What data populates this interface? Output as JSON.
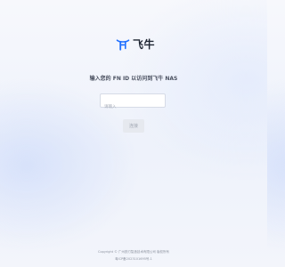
{
  "brand": {
    "name": "飞牛",
    "logo_icon": "fnos-bull-icon",
    "logo_color": "#1f6fff"
  },
  "login": {
    "prompt": "输入您的 FN ID 以访问到飞牛 NAS",
    "input_placeholder": "请输入",
    "input_value": "",
    "submit_label": "连接"
  },
  "footer": {
    "copyright": "Copyright © 广州铁刃智造技术有限公司 版权所有",
    "icp": "粤ICP备2023101695号-1"
  },
  "colors": {
    "accent": "#1f6fff",
    "button_disabled_bg": "#e6e9ef",
    "button_disabled_text": "#a3a9b4"
  }
}
